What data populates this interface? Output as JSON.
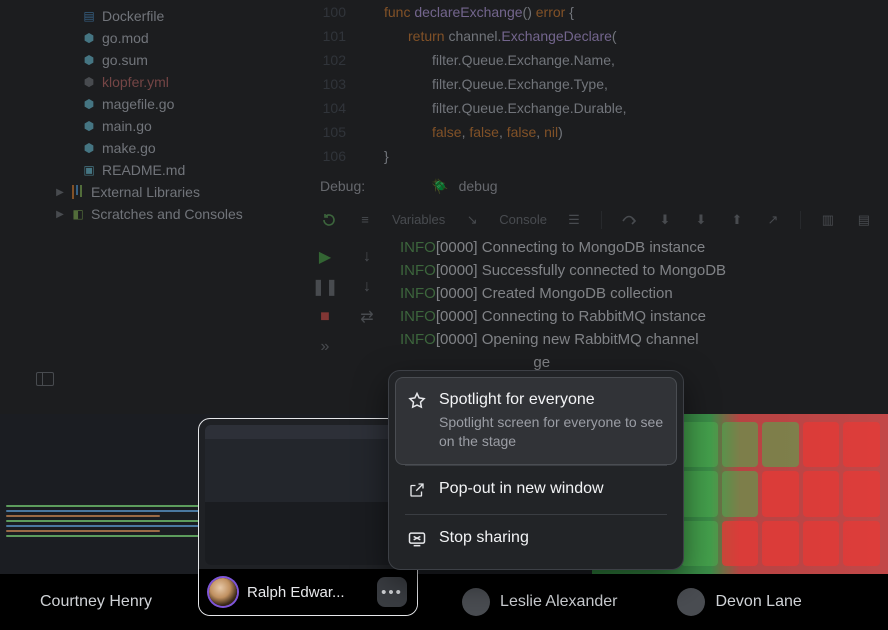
{
  "sidebar": {
    "files": [
      {
        "icon": "docker",
        "label": "Dockerfile"
      },
      {
        "icon": "go",
        "label": "go.mod"
      },
      {
        "icon": "go",
        "label": "go.sum"
      },
      {
        "icon": "go",
        "label": "klopfer.yml",
        "selected": true
      },
      {
        "icon": "go",
        "label": "magefile.go"
      },
      {
        "icon": "go",
        "label": "main.go"
      },
      {
        "icon": "go",
        "label": "make.go"
      },
      {
        "icon": "readme",
        "label": "README.md"
      }
    ],
    "external_libs": "External Libraries",
    "scratches": "Scratches and Consoles"
  },
  "editor": {
    "gutter": [
      "100",
      "101",
      "102",
      "103",
      "104",
      "105",
      "106"
    ],
    "lines": {
      "l0": {
        "kw": "func ",
        "fn": "declareExchange",
        "plain": "() ",
        "kw2": "error",
        "brace": " {"
      },
      "l1": {
        "kw": "return ",
        "plain": "channel.",
        "fn": "ExchangeDeclare",
        "paren": "("
      },
      "l2": {
        "plain": "filter.Queue.Exchange.Name,"
      },
      "l3": {
        "plain": "filter.Queue.Exchange.Type,"
      },
      "l4": {
        "plain": "filter.Queue.Exchange.Durable,"
      },
      "l5": {
        "kw": "false",
        "plain": ", ",
        "kw2": "false",
        "plain2": ", ",
        "kw3": "false",
        "plain3": ", ",
        "kw4": "nil",
        "paren": ")"
      },
      "l6": {
        "brace": "}"
      }
    }
  },
  "debug": {
    "label": "Debug:",
    "target": "debug",
    "tabs": {
      "variables": "Variables",
      "console": "Console"
    }
  },
  "console_lines": [
    {
      "level": "INFO",
      "ts": "[0000]",
      "msg": " Connecting to MongoDB instance"
    },
    {
      "level": "INFO",
      "ts": "[0000]",
      "msg": " Successfully connected to MongoDB"
    },
    {
      "level": "INFO",
      "ts": "[0000]",
      "msg": " Created MongoDB collection"
    },
    {
      "level": "INFO",
      "ts": "[0000]",
      "msg": " Connecting to RabbitMQ instance"
    },
    {
      "level": "INFO",
      "ts": "[0000]",
      "msg": " Opening new RabbitMQ channel"
    },
    {
      "level": "",
      "ts": "",
      "msg": "                                ge"
    }
  ],
  "menu": {
    "spotlight": {
      "title": "Spotlight for everyone",
      "sub": "Spotlight screen for everyone to see on the stage"
    },
    "popout": "Pop-out in new window",
    "stop": "Stop sharing"
  },
  "participants": {
    "courtney": "Courtney Henry",
    "ralph": "Ralph Edwar...",
    "leslie": "Leslie Alexander",
    "devon": "Devon Lane"
  },
  "more_btn": "•••"
}
